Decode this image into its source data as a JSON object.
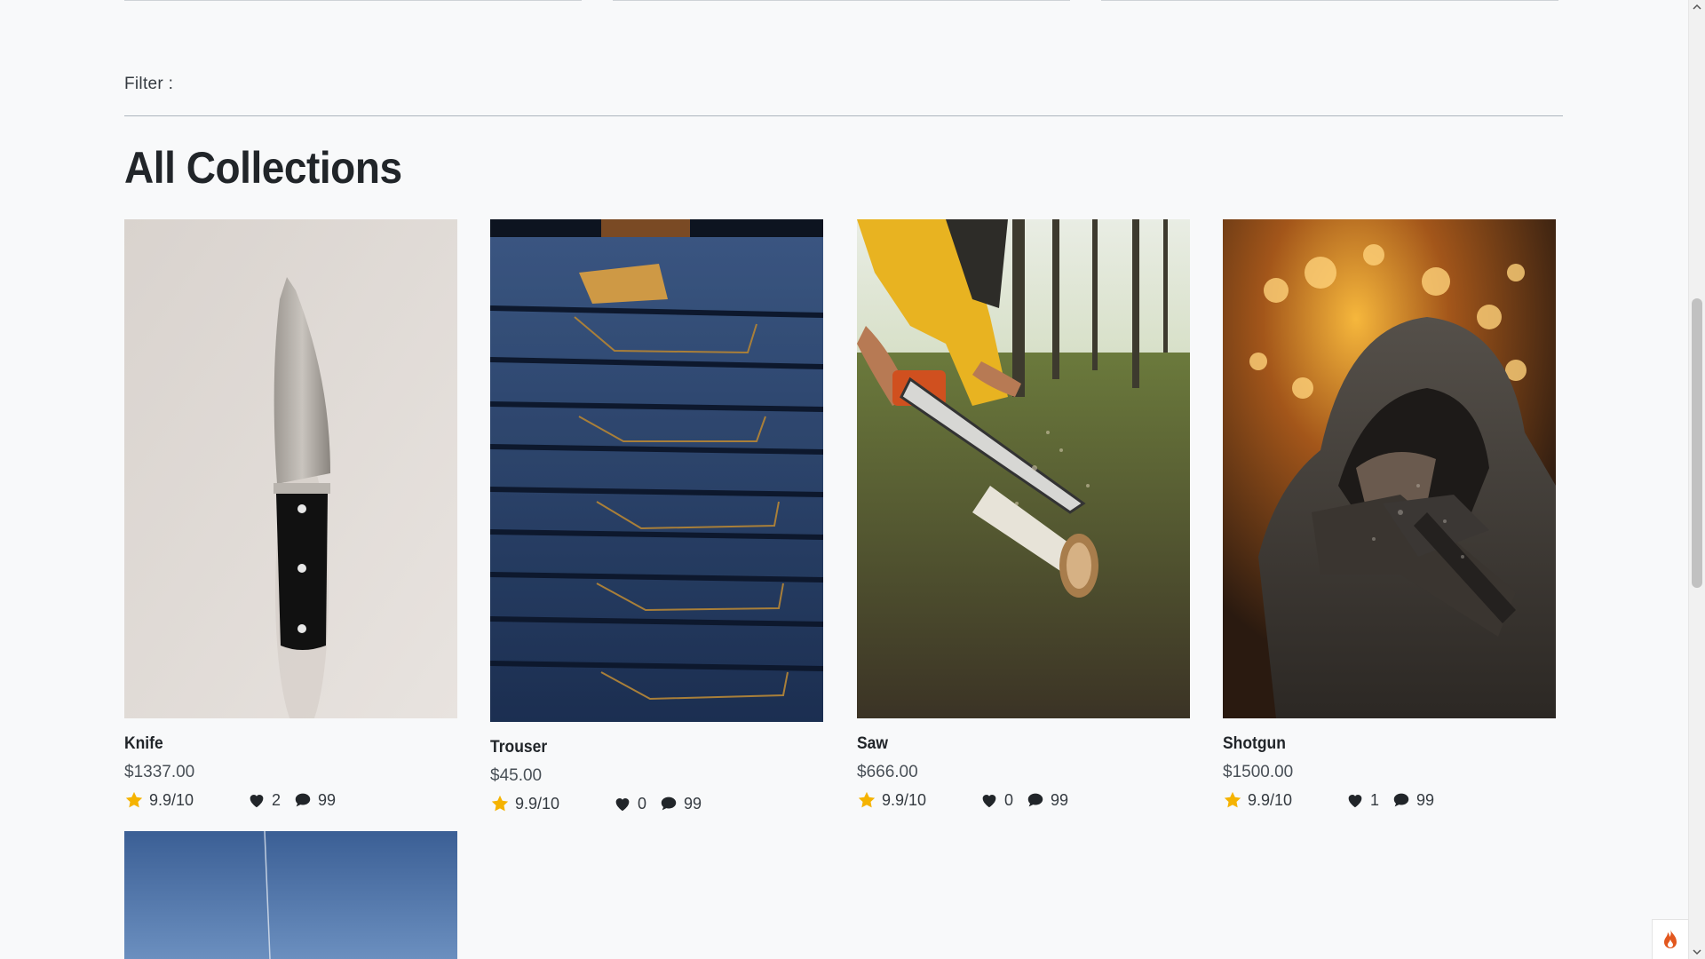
{
  "filter": {
    "label": "Filter :"
  },
  "section": {
    "title": "All Collections"
  },
  "colors": {
    "star": "#f5b301",
    "text": "#212529",
    "background": "#f8f9fa"
  },
  "products": [
    {
      "name": "Knife",
      "price": "$1337.00",
      "rating": "9.9/10",
      "likes": "2",
      "comments": "99",
      "image": "knife-photo"
    },
    {
      "name": "Trouser",
      "price": "$45.00",
      "rating": "9.9/10",
      "likes": "0",
      "comments": "99",
      "image": "stacked-jeans-photo"
    },
    {
      "name": "Saw",
      "price": "$666.00",
      "rating": "9.9/10",
      "likes": "0",
      "comments": "99",
      "image": "chainsaw-cutting-log-photo"
    },
    {
      "name": "Shotgun",
      "price": "$1500.00",
      "rating": "9.9/10",
      "likes": "1",
      "comments": "99",
      "image": "hooded-figure-sparks-photo"
    }
  ],
  "icons": {
    "rating": "star-icon",
    "likes": "heart-icon",
    "comments": "comment-icon",
    "corner_button": "fire-icon"
  }
}
